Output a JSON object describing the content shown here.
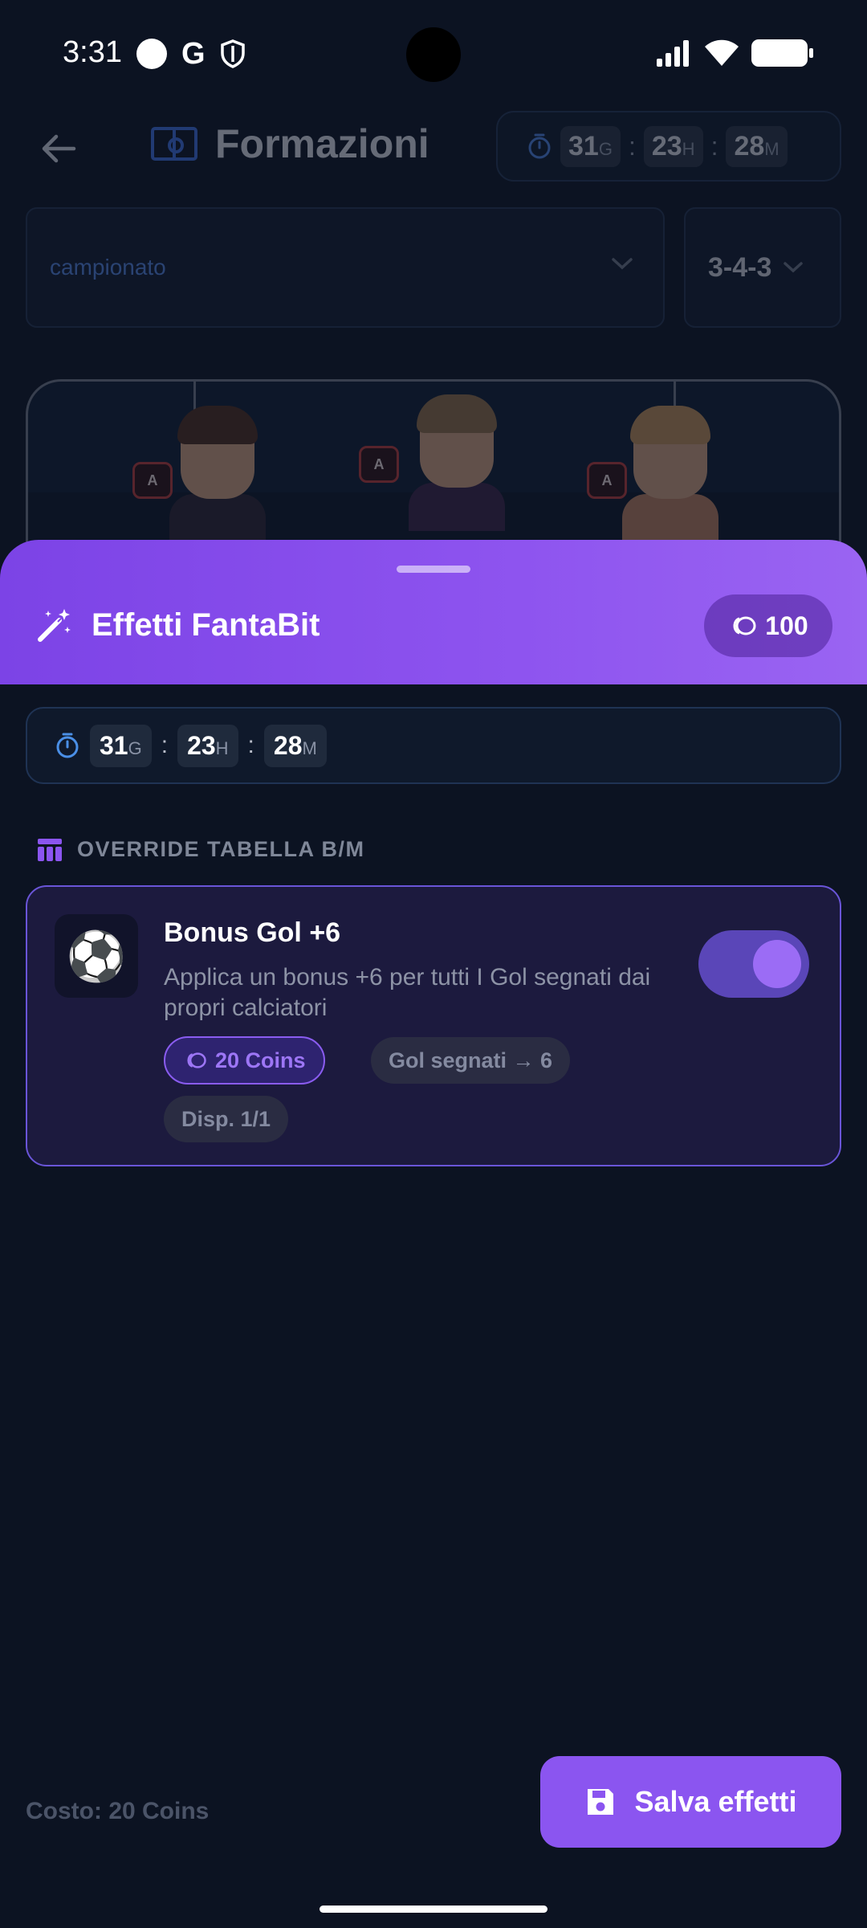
{
  "status_bar": {
    "time": "3:31",
    "icons": [
      "circle-icon",
      "google-icon",
      "shield-icon",
      "signal-icon",
      "wifi-icon",
      "battery-icon"
    ]
  },
  "background_screen": {
    "title": "Formazioni",
    "back_icon": "arrow-left-icon",
    "title_icon": "soccer-field-icon",
    "countdown": {
      "days": "31",
      "days_unit": "G",
      "hours": "23",
      "hours_unit": "H",
      "minutes": "28",
      "minutes_unit": "M",
      "separator": ":"
    },
    "league_select": {
      "value": "campionato"
    },
    "formation_select": {
      "value": "3-4-3"
    },
    "players": [
      {
        "badge": "A",
        "hair": "#4a2d1f",
        "shirt": "#2c2433"
      },
      {
        "badge": "A",
        "hair": "#8a6a47",
        "shirt": "#3a2346"
      },
      {
        "badge": "A",
        "hair": "#b88a55",
        "shirt": "#b27a5c"
      }
    ]
  },
  "sheet": {
    "title": "Effetti FantaBit",
    "title_icon": "magic-wand-icon",
    "coins": "100",
    "countdown": {
      "days": "31",
      "days_unit": "G",
      "hours": "23",
      "hours_unit": "H",
      "minutes": "28",
      "minutes_unit": "M",
      "separator": ":"
    },
    "section_label": "OVERRIDE TABELLA B/M",
    "section_icon": "table-icon",
    "effect_card": {
      "icon": "⚽",
      "title": "Bonus Gol +6",
      "description": "Applica un bonus +6 per tutti I Gol segnati dai propri calciatori",
      "toggle_on": true,
      "price_chip": "20 Coins",
      "rule_chip": "Gol segnati → 6",
      "availability_chip": "Disp. 1/1"
    },
    "cost_label": "Costo: 20 Coins",
    "save_button": "Salva effetti"
  },
  "colors": {
    "accent": "#8b55f0",
    "background": "#0c1322",
    "card_border": "#6a55d8"
  }
}
